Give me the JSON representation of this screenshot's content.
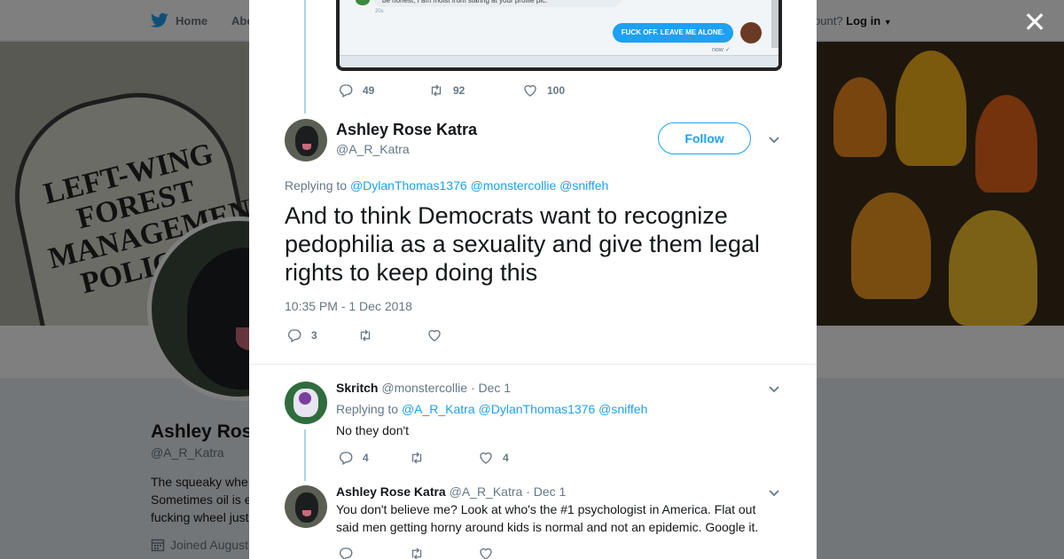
{
  "nav": {
    "home_label": "Home",
    "about_label": "Abo",
    "account_text": "ccount?",
    "login_label": "Log in"
  },
  "profile": {
    "banner_text": "LEFT-WING FOREST MANAGEMENT POLICIES",
    "name": "Ashley Ros",
    "handle": "@A_R_Katra",
    "bio_line1": "The squeaky whe",
    "bio_line2": "Sometimes oil is e",
    "bio_line3": "fucking wheel just",
    "joined": "Joined August"
  },
  "screenshot": {
    "incoming_text": "be honest, I am moist from staring at your profile pic.",
    "incoming_time": "20s",
    "outgoing_text": "FUCK OFF. LEAVE ME ALONE.",
    "outgoing_time": "now ✓"
  },
  "parent_tweet": {
    "replies": "49",
    "retweets": "92",
    "likes": "100"
  },
  "main_tweet": {
    "fullname": "Ashley Rose Katra",
    "username": "@A_R_Katra",
    "follow_label": "Follow",
    "replying_prefix": "Replying to",
    "mentions": [
      "@DylanThomas1376",
      "@monstercollie",
      "@sniffeh"
    ],
    "text": "And to think Democrats want to recognize pedophilia as a sexuality and give them legal rights to keep doing this",
    "timestamp": "10:35 PM - 1 Dec 2018",
    "replies": "3",
    "retweets": "",
    "likes": ""
  },
  "replies": [
    {
      "fullname": "Skritch",
      "username": "@monstercollie",
      "date": "· Dec 1",
      "replying_prefix": "Replying to",
      "mentions": [
        "@A_R_Katra",
        "@DylanThomas1376",
        "@sniffeh"
      ],
      "text": "No they don't",
      "replies": "4",
      "retweets": "",
      "likes": "4"
    },
    {
      "fullname": "Ashley Rose Katra",
      "username": "@A_R_Katra",
      "date": "· Dec 1",
      "text": "You don't believe me? Look at who's the #1 psychologist in America. Flat out said men getting horny around kids is normal and not an epidemic. Google it."
    }
  ],
  "colors": {
    "accent": "#1da1f2",
    "text": "#14171a",
    "secondary": "#657786",
    "thread_line": "#a8d5f5"
  }
}
